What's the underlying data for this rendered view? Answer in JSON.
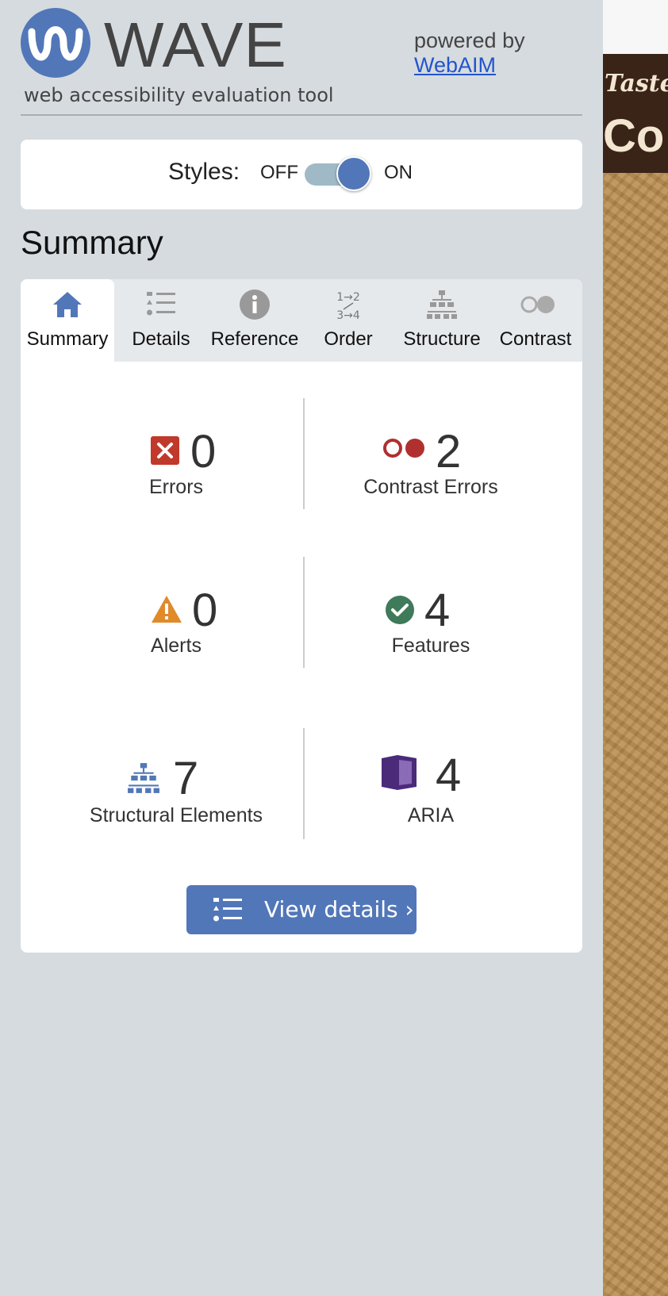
{
  "header": {
    "logo_word": "WAVE",
    "tagline": "web accessibility evaluation tool",
    "powered_by": "powered by",
    "powered_link": "WebAIM"
  },
  "styles_toggle": {
    "label": "Styles:",
    "off": "OFF",
    "on": "ON",
    "state": "on"
  },
  "summary": {
    "heading": "Summary",
    "tabs": [
      {
        "label": "Summary",
        "icon": "home-icon",
        "active": true
      },
      {
        "label": "Details",
        "icon": "list-icon",
        "active": false
      },
      {
        "label": "Reference",
        "icon": "info-icon",
        "active": false
      },
      {
        "label": "Order",
        "icon": "order-icon",
        "order_text_top": "1→2",
        "order_text_bottom": "3→4",
        "active": false
      },
      {
        "label": "Structure",
        "icon": "structure-icon",
        "active": false
      },
      {
        "label": "Contrast",
        "icon": "contrast-icon",
        "active": false
      }
    ],
    "stats": {
      "errors": {
        "count": "0",
        "label": "Errors",
        "icon": "error-icon",
        "color": "#c0392b"
      },
      "contrast_errors": {
        "count": "2",
        "label": "Contrast Errors",
        "icon": "contrast-error-icon",
        "color": "#b03030"
      },
      "alerts": {
        "count": "0",
        "label": "Alerts",
        "icon": "alert-icon",
        "color": "#e08a2a"
      },
      "features": {
        "count": "4",
        "label": "Features",
        "icon": "feature-check-icon",
        "color": "#3f7a5a"
      },
      "structural": {
        "count": "7",
        "label": "Structural Elements",
        "icon": "structure-icon",
        "color": "#5277b8"
      },
      "aria": {
        "count": "4",
        "label": "ARIA",
        "icon": "aria-icon",
        "color": "#4b2a7a"
      }
    },
    "view_details": "View details ›"
  },
  "preview": {
    "script_text": "Taste",
    "heading_text": "Co"
  },
  "colors": {
    "accent": "#5277b8",
    "sidebar_bg": "#d6dbe0",
    "link": "#2255cc"
  }
}
